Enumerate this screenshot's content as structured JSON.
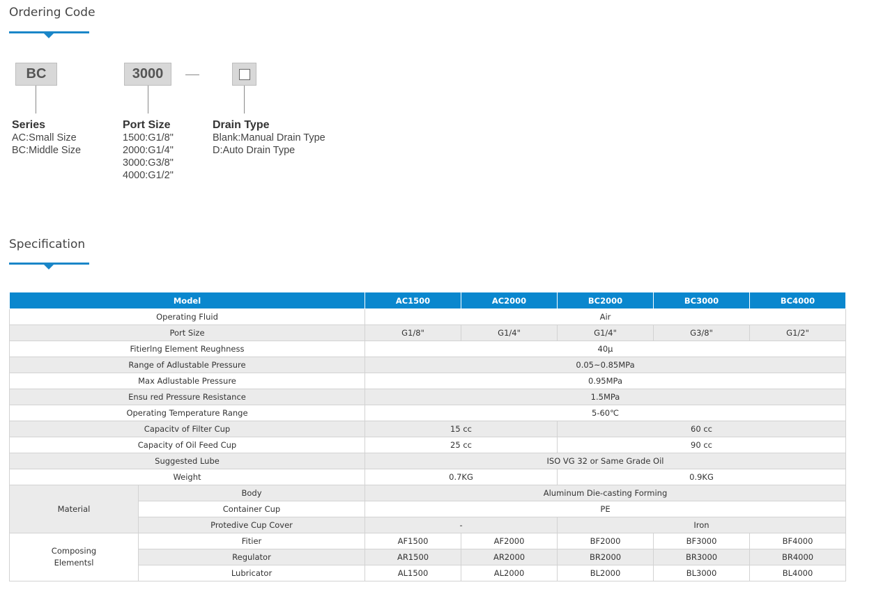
{
  "ordering": {
    "title": "Ordering Code",
    "series_code": "BC",
    "port_code": "3000",
    "groups": {
      "series": {
        "title": "Series",
        "lines": [
          "AC:Small Size",
          "BC:Middle Size"
        ]
      },
      "port": {
        "title": "Port Size",
        "lines": [
          "1500:G1/8\"",
          "2000:G1/4\"",
          "3000:G3/8\"",
          "4000:G1/2\""
        ]
      },
      "drain": {
        "title": "Drain Type",
        "lines": [
          "Blank:Manual Drain Type",
          "D:Auto Drain Type"
        ]
      }
    }
  },
  "spec": {
    "title": "Specification",
    "header": {
      "model": "Model",
      "models": [
        "AC1500",
        "AC2000",
        "BC2000",
        "BC3000",
        "BC4000"
      ]
    },
    "rows": {
      "fluid": {
        "label": "Operating Fluid",
        "value": "Air"
      },
      "port": {
        "label": "Port Size",
        "values": [
          "G1/8\"",
          "G1/4\"",
          "G1/4\"",
          "G3/8\"",
          "G1/2\""
        ]
      },
      "filter_roughness": {
        "label": "Fitierlng Element Reughness",
        "value": "40μ"
      },
      "adj_range": {
        "label": "Range of Adlustable Pressure",
        "value": "0.05~0.85MPa"
      },
      "max_adj": {
        "label": "Max Adlustable Pressure",
        "value": "0.95MPa"
      },
      "ensured": {
        "label": "Ensu red Pressure Resistance",
        "value": "1.5MPa"
      },
      "temp": {
        "label": "Operating Temperature Range",
        "value": "5-60℃"
      },
      "filter_cup": {
        "label": "Capacitv of Filter Cup",
        "values": [
          "15 cc",
          "60 cc"
        ]
      },
      "oil_cup": {
        "label": "Capacity of Oil Feed Cup",
        "values": [
          "25 cc",
          "90 cc"
        ]
      },
      "lube": {
        "label": "Suggested Lube",
        "value": "ISO VG 32 or Same Grade Oil"
      },
      "weight": {
        "label": "Weight",
        "values": [
          "0.7KG",
          "0.9KG"
        ]
      }
    },
    "material": {
      "label": "Material",
      "body": {
        "label": "Body",
        "value": "Aluminum Die-casting Forming"
      },
      "container": {
        "label": "Container Cup",
        "value": "PE"
      },
      "cover": {
        "label": "Protedive Cup Cover",
        "values": [
          "-",
          "Iron"
        ]
      }
    },
    "composing": {
      "label_line1": "Composing",
      "label_line2": "Elementsl",
      "filter": {
        "label": "Fitier",
        "values": [
          "AF1500",
          "AF2000",
          "BF2000",
          "BF3000",
          "BF4000"
        ]
      },
      "regulator": {
        "label": "Regulator",
        "values": [
          "AR1500",
          "AR2000",
          "BR2000",
          "BR3000",
          "BR4000"
        ]
      },
      "lubricator": {
        "label": "Lubricator",
        "values": [
          "AL1500",
          "AL2000",
          "BL2000",
          "BL3000",
          "BL4000"
        ]
      }
    }
  },
  "colors": {
    "accent": "#1a86c8",
    "header_bg": "#0a87ce",
    "row_shade": "#ebebeb",
    "code_box_bg": "#d8d8d8"
  }
}
